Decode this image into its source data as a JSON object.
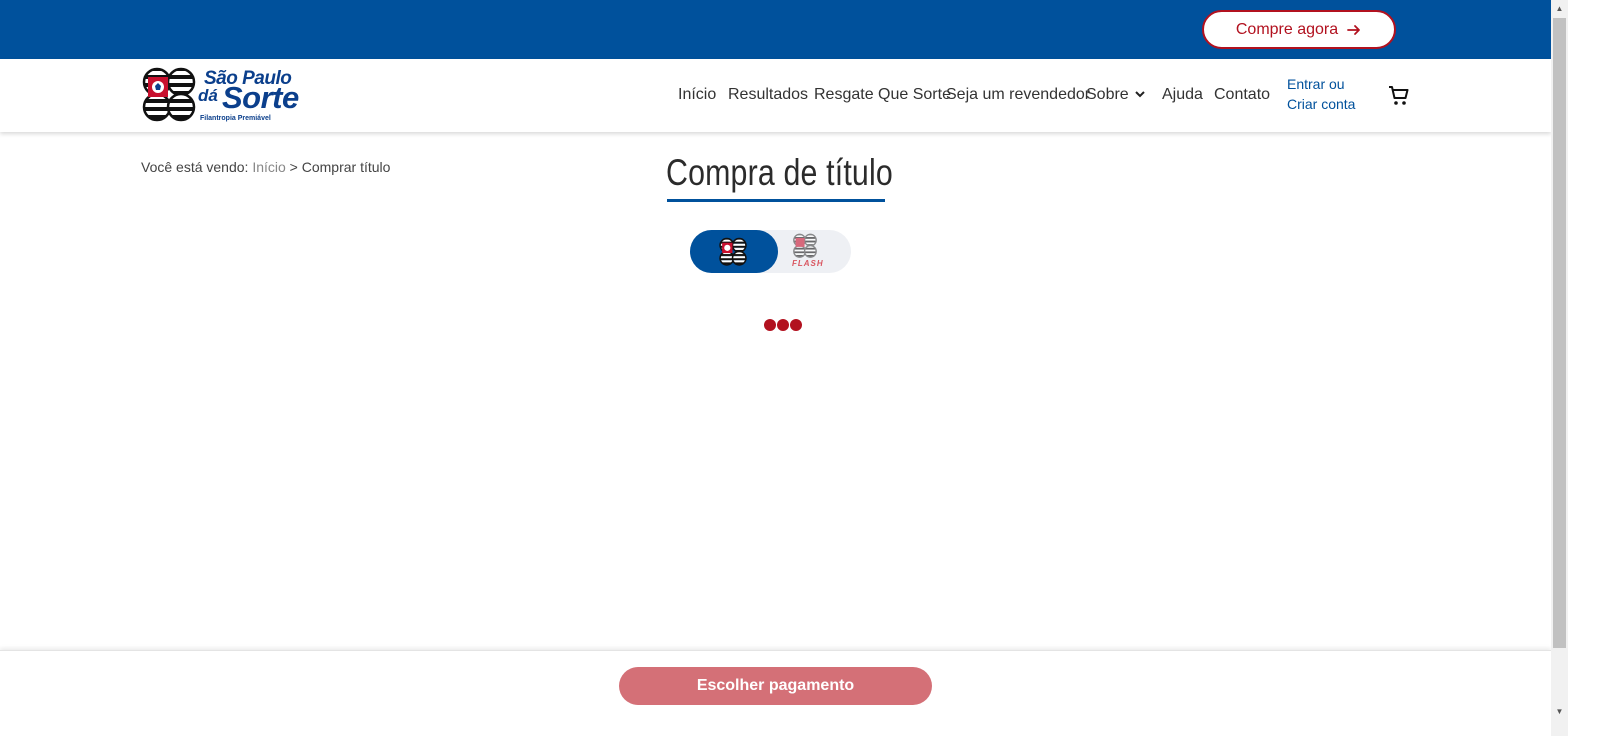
{
  "topbar": {
    "cta_label": "Compre agora",
    "cta_icon": "arrow-right-icon",
    "bg_color": "#00519c",
    "accent_color": "#b2111f"
  },
  "logo": {
    "line1": "São Paulo",
    "line2a": "dá",
    "line2b": "Sorte",
    "tagline": "Filantropia Premiável"
  },
  "nav": {
    "items": [
      "Início",
      "Resultados",
      "Resgate Que Sorte",
      "Seja um revendedor",
      "Sobre",
      "Ajuda",
      "Contato"
    ],
    "account_line1": "Entrar ou",
    "account_line2": "Criar conta",
    "cart_icon": "cart-icon"
  },
  "breadcrumb": {
    "prefix": "Você está vendo:",
    "link": "Início",
    "separator": ">",
    "current": "Comprar título"
  },
  "main": {
    "title": "Compra de título",
    "toggle": {
      "flash_label": "FLASH",
      "selected": "São Paulo dá Sorte"
    },
    "loading": true
  },
  "footer": {
    "pay_button_label": "Escolher pagamento",
    "pay_button_color": "#d47077"
  }
}
